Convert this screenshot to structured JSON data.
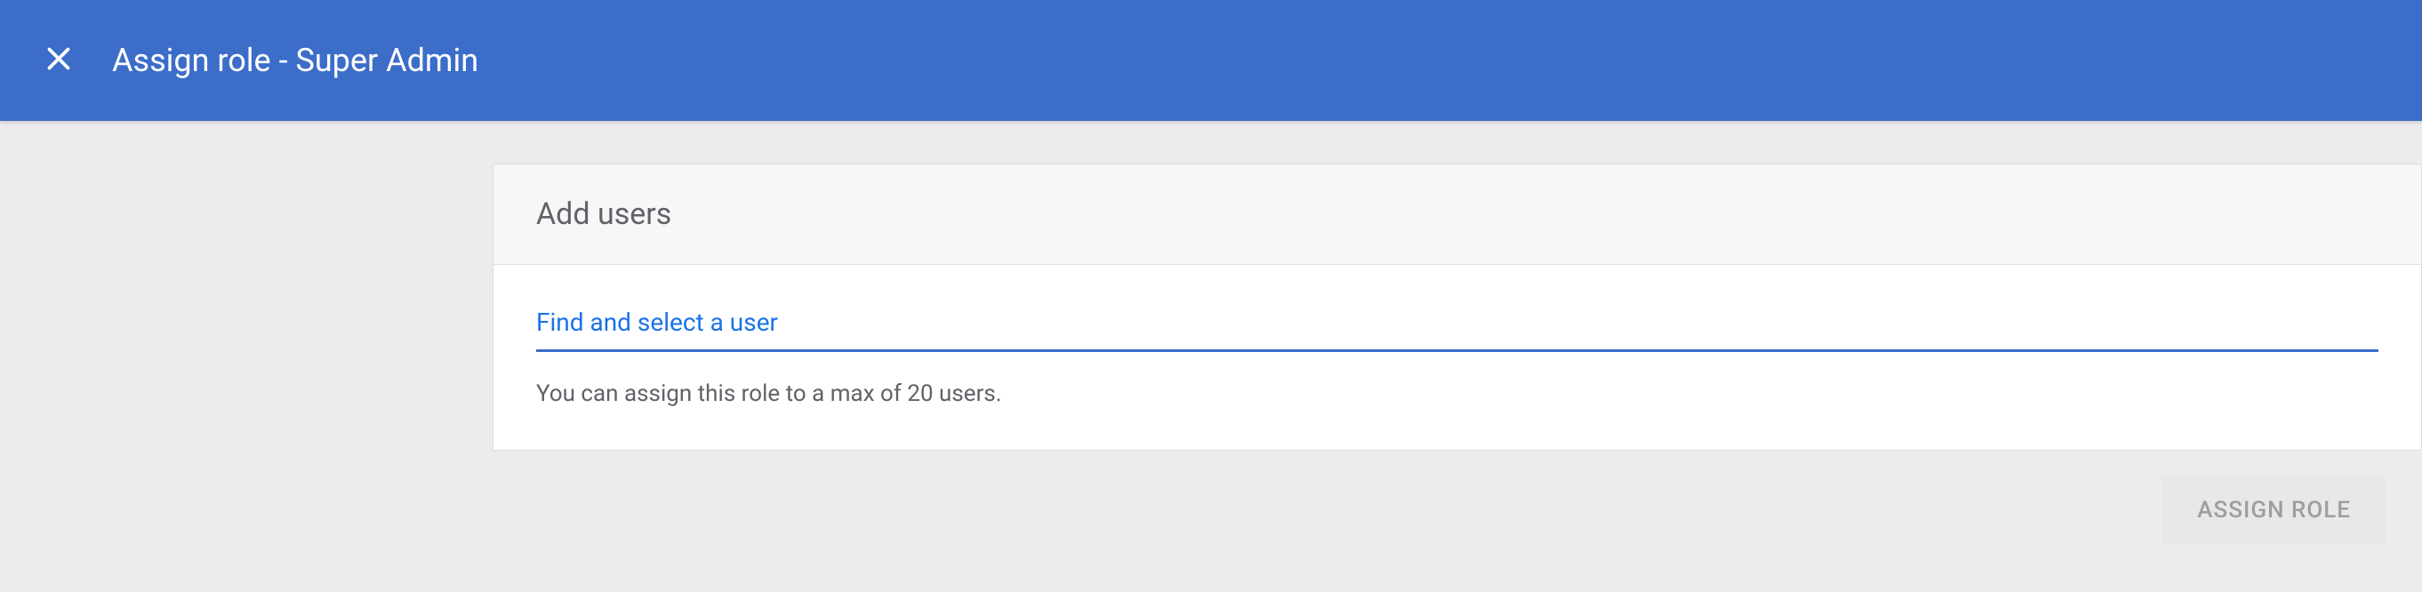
{
  "header": {
    "title": "Assign role - Super Admin"
  },
  "card": {
    "title": "Add users",
    "search_placeholder": "Find and select a user",
    "helper_text": "You can assign this role to a max of 20 users."
  },
  "footer": {
    "assign_label": "ASSIGN ROLE"
  }
}
